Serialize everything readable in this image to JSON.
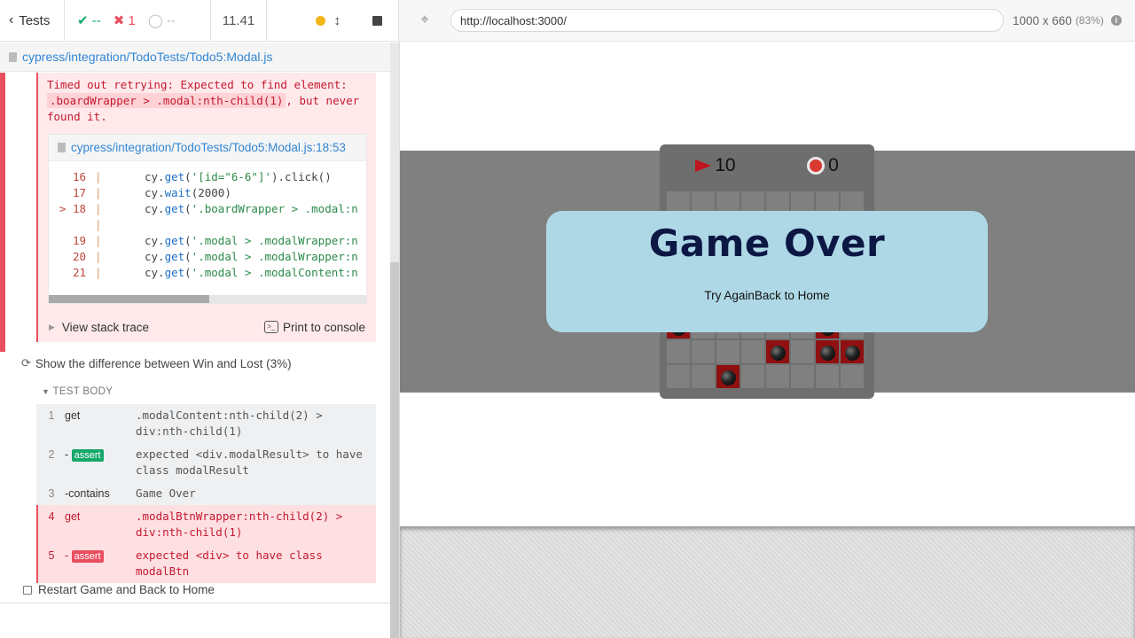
{
  "stats": {
    "tests_label": "Tests",
    "passed": "--",
    "failed": "1",
    "pending": "--",
    "duration": "11.41"
  },
  "spec": {
    "path": "cypress/integration/TodoTests/Todo5:Modal.js"
  },
  "error": {
    "message_prefix": "Timed out retrying: Expected to find element:",
    "selector": ".boardWrapper > .modal:nth-child(1)",
    "message_suffix": ", but never found it.",
    "frame_path": "cypress/integration/TodoTests/Todo5:Modal.js:18:53",
    "code_lines": [
      {
        "ln": "16",
        "pre": "cy.",
        "method": "get",
        "mid": "(",
        "str": "'[id=\"6-6\"]'",
        "post": ").click()"
      },
      {
        "ln": "17",
        "pre": "cy.",
        "method": "wait",
        "mid": "(2000)",
        "str": "",
        "post": ""
      },
      {
        "ln": "> 18",
        "pre": "cy.",
        "method": "get",
        "mid": "(",
        "str": "'.boardWrapper > .modal:n",
        "post": ""
      },
      {
        "ln": "",
        "pre": "",
        "method": "",
        "mid": "",
        "str": "",
        "post": ""
      },
      {
        "ln": "19",
        "pre": "cy.",
        "method": "get",
        "mid": "(",
        "str": "'.modal > .modalWrapper:n",
        "post": ""
      },
      {
        "ln": "20",
        "pre": "cy.",
        "method": "get",
        "mid": "(",
        "str": "'.modal > .modalWrapper:n",
        "post": ""
      },
      {
        "ln": "21",
        "pre": "cy.",
        "method": "get",
        "mid": "(",
        "str": "'.modal > .modalContent:n",
        "post": ""
      }
    ],
    "view_stack": "View stack trace",
    "print_console": "Print to console"
  },
  "test": {
    "title": "Show the difference between Win and Lost (3%)",
    "body_header": "TEST BODY",
    "commands": [
      {
        "n": "1",
        "name": "get",
        "badge": "",
        "msg": ".modalContent:nth-child(2) > div:nth-child(1)",
        "state": "ok"
      },
      {
        "n": "2",
        "name": "-",
        "badge": "assert",
        "msg": "expected <div.modalResult> to have class modalResult",
        "state": "ok"
      },
      {
        "n": "3",
        "name": "-contains",
        "badge": "",
        "msg": "Game Over",
        "state": "ok"
      },
      {
        "n": "4",
        "name": "get",
        "badge": "",
        "msg": ".modalBtnWrapper:nth-child(2) > div:nth-child(1)",
        "state": "bad"
      },
      {
        "n": "5",
        "name": "-",
        "badge": "assert",
        "msg": "expected <div> to have class modalBtn",
        "state": "bad"
      }
    ],
    "next_test": "Restart Game and Back to Home"
  },
  "browser": {
    "url": "http://localhost:3000/",
    "viewport": "1000 x 660",
    "scale": "(83%)"
  },
  "game": {
    "flags": "10",
    "time": "0",
    "modal_title": "Game Over",
    "try_again": "Try Again",
    "back_home": "Back to Home",
    "mines": [
      [
        5,
        0
      ],
      [
        5,
        6
      ],
      [
        6,
        4
      ],
      [
        6,
        6
      ],
      [
        6,
        7
      ],
      [
        7,
        2
      ]
    ]
  }
}
